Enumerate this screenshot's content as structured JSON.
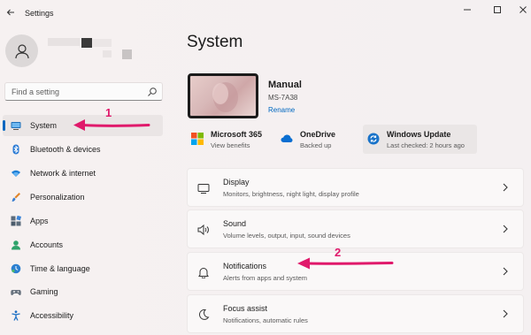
{
  "window": {
    "title": "Settings"
  },
  "search": {
    "placeholder": "Find a setting"
  },
  "sidebar": {
    "items": [
      {
        "label": "System",
        "icon": "display-icon",
        "active": true
      },
      {
        "label": "Bluetooth & devices",
        "icon": "bluetooth-icon"
      },
      {
        "label": "Network & internet",
        "icon": "wifi-icon"
      },
      {
        "label": "Personalization",
        "icon": "brush-icon"
      },
      {
        "label": "Apps",
        "icon": "apps-icon"
      },
      {
        "label": "Accounts",
        "icon": "person-icon"
      },
      {
        "label": "Time & language",
        "icon": "globe-clock-icon"
      },
      {
        "label": "Gaming",
        "icon": "gamepad-icon"
      },
      {
        "label": "Accessibility",
        "icon": "accessibility-icon"
      }
    ]
  },
  "main": {
    "title": "System",
    "device": {
      "name": "Manual",
      "model": "MS-7A38",
      "rename_label": "Rename"
    },
    "quick": [
      {
        "title": "Microsoft 365",
        "subtitle": "View benefits",
        "icon": "microsoft-logo-icon"
      },
      {
        "title": "OneDrive",
        "subtitle": "Backed up",
        "icon": "cloud-icon"
      },
      {
        "title": "Windows Update",
        "subtitle": "Last checked: 2 hours ago",
        "icon": "sync-icon"
      }
    ],
    "cards": [
      {
        "title": "Display",
        "subtitle": "Monitors, brightness, night light, display profile",
        "icon": "monitor-icon"
      },
      {
        "title": "Sound",
        "subtitle": "Volume levels, output, input, sound devices",
        "icon": "speaker-icon"
      },
      {
        "title": "Notifications",
        "subtitle": "Alerts from apps and system",
        "icon": "bell-icon"
      },
      {
        "title": "Focus assist",
        "subtitle": "Notifications, automatic rules",
        "icon": "moon-icon"
      }
    ]
  },
  "annotations": {
    "step1": "1",
    "step2": "2"
  },
  "colors": {
    "accent": "#0067c0",
    "annotation": "#e0196b"
  }
}
